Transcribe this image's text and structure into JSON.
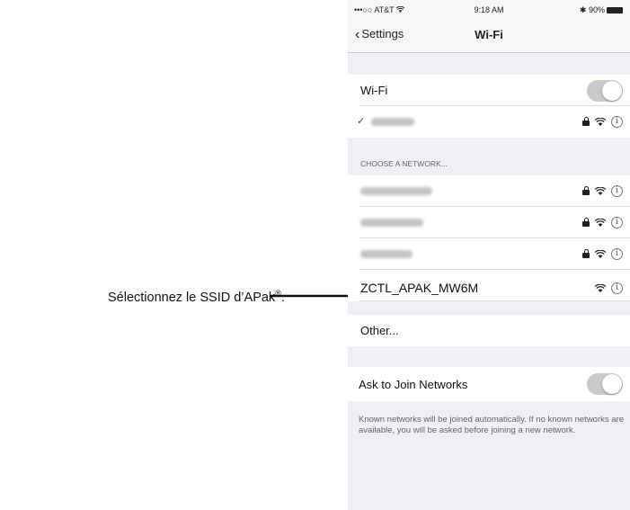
{
  "annotation": {
    "text": "Sélectionnez le SSID d’APak",
    "registered": "®",
    "suffix": "."
  },
  "status_bar": {
    "carrier": "•••○○ AT&T",
    "time": "9:18 AM",
    "battery": "90%"
  },
  "nav": {
    "back_label": "Settings",
    "title": "Wi-Fi"
  },
  "wifi_toggle": {
    "label": "Wi-Fi",
    "state": "on"
  },
  "section_header": "CHOOSE A NETWORK...",
  "networks": [
    {
      "name": "ZCTL_APAK_MW6M"
    },
    {
      "name": "Other..."
    }
  ],
  "ask_to_join": {
    "label": "Ask to Join Networks",
    "state": "on"
  },
  "footer_text": "Known networks will be joined automatically. If no known networks are available, you will be asked before joining a new network.",
  "icons": {
    "info": "info-icon",
    "lock": "lock-icon",
    "wifi": "wifi-icon",
    "check": "checkmark-icon",
    "back": "chevron-left-icon"
  },
  "colors": {
    "grouped_background": "#efeff4",
    "toggle_track": "#c9c9cc",
    "text_primary": "#111111",
    "text_secondary": "#666666"
  }
}
